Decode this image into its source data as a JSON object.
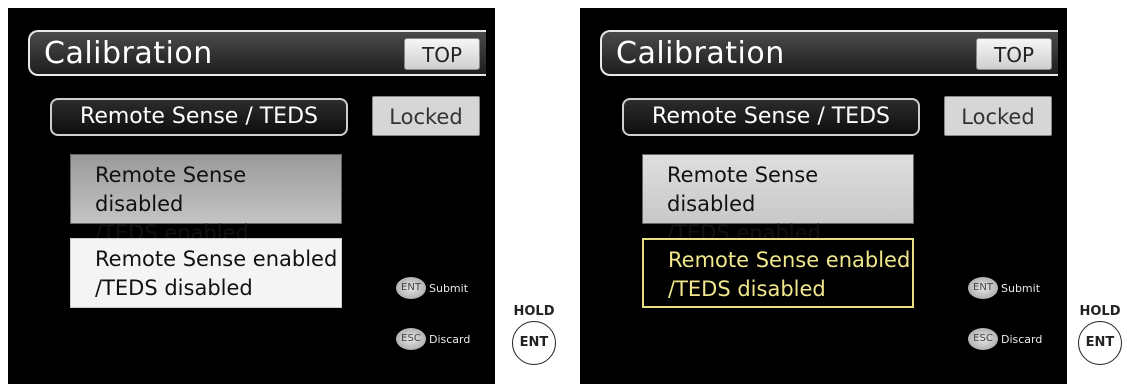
{
  "screens": [
    {
      "title": "Calibration",
      "top_button": "TOP",
      "mode": "Remote Sense / TEDS",
      "lock_status": "Locked",
      "options": [
        {
          "line1": "Remote Sense disabled",
          "line2": "/TEDS enabled"
        },
        {
          "line1": "Remote Sense enabled",
          "line2": "/TEDS disabled"
        }
      ],
      "softkeys": [
        {
          "key": "ENT",
          "label": "Submit"
        },
        {
          "key": "ESC",
          "label": "Discard"
        }
      ]
    },
    {
      "title": "Calibration",
      "top_button": "TOP",
      "mode": "Remote Sense / TEDS",
      "lock_status": "Locked",
      "options": [
        {
          "line1": "Remote Sense disabled",
          "line2": "/TEDS enabled"
        },
        {
          "line1": "Remote Sense enabled",
          "line2": "/TEDS disabled"
        }
      ],
      "softkeys": [
        {
          "key": "ENT",
          "label": "Submit"
        },
        {
          "key": "ESC",
          "label": "Discard"
        }
      ]
    }
  ],
  "hold_key": {
    "caption": "HOLD",
    "key": "ENT"
  },
  "colors": {
    "selected_text": "#f0e68c",
    "selected_border": "#e8e080",
    "screen_bg": "#000000"
  }
}
